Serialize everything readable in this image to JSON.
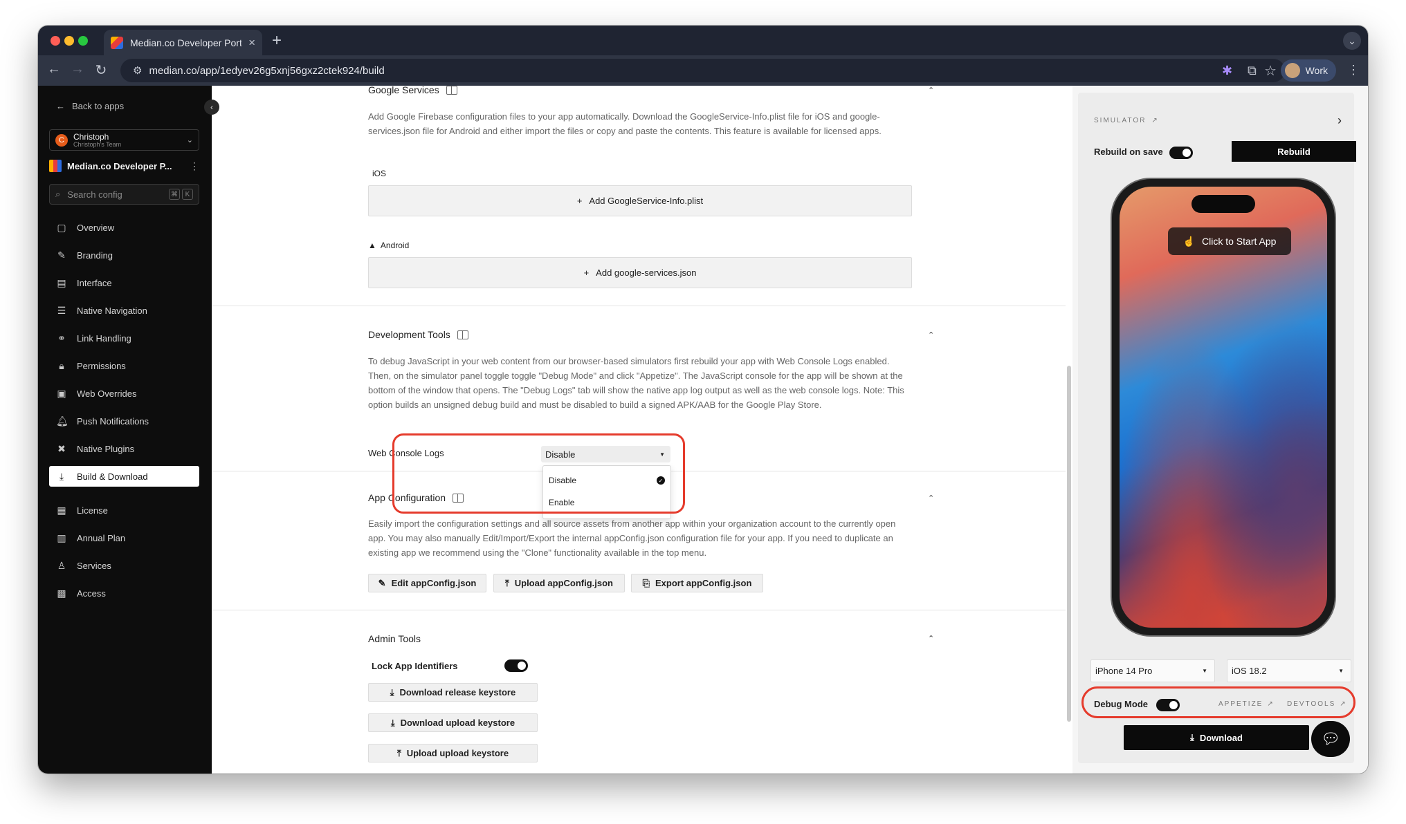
{
  "browser": {
    "tab_title": "Median.co Developer Portal -",
    "tab_close": "×",
    "new_tab": "+",
    "url": "median.co/app/1edyev26g5xnj56gxz2ctek924/build",
    "profile_label": "Work"
  },
  "sidebar": {
    "back_label": "Back to apps",
    "team_name": "Christoph",
    "team_sub": "Christoph's Team",
    "team_initial": "C",
    "app_name": "Median.co Developer P...",
    "search_placeholder": "Search config",
    "search_kbd": [
      "⌘",
      "K"
    ],
    "items": [
      {
        "label": "Overview",
        "icon": "square-icon"
      },
      {
        "label": "Branding",
        "icon": "brush-icon"
      },
      {
        "label": "Interface",
        "icon": "layout-icon"
      },
      {
        "label": "Native Navigation",
        "icon": "navigation-icon"
      },
      {
        "label": "Link Handling",
        "icon": "link-icon"
      },
      {
        "label": "Permissions",
        "icon": "lock-icon"
      },
      {
        "label": "Web Overrides",
        "icon": "code-icon"
      },
      {
        "label": "Push Notifications",
        "icon": "bell-icon"
      },
      {
        "label": "Native Plugins",
        "icon": "plugin-icon"
      },
      {
        "label": "Build & Download",
        "icon": "download-icon",
        "active": true
      }
    ],
    "items2": [
      {
        "label": "License",
        "icon": "license-icon"
      },
      {
        "label": "Annual Plan",
        "icon": "calendar-icon"
      },
      {
        "label": "Services",
        "icon": "person-icon"
      },
      {
        "label": "Access",
        "icon": "access-icon"
      }
    ]
  },
  "google_services": {
    "title": "Google Services",
    "description": "Add Google Firebase configuration files to your app automatically. Download the GoogleService-Info.plist file for iOS and google-services.json file for Android and either import the files or copy and paste the contents. This feature is available for licensed apps.",
    "ios_label": "iOS",
    "ios_button": "Add GoogleService-Info.plist",
    "android_label": "Android",
    "android_button": "Add google-services.json"
  },
  "dev_tools": {
    "title": "Development Tools",
    "description": "To debug JavaScript in your web content from our browser-based simulators first rebuild your app with Web Console Logs enabled. Then, on the simulator panel toggle toggle \"Debug Mode\" and click \"Appetize\". The JavaScript console for the app will be shown at the bottom of the window that opens. The \"Debug Logs\" tab will show the native app log output as well as the web console logs. Note: This option builds an unsigned debug build and must be disabled to build a signed APK/AAB for the Google Play Store.",
    "web_console_label": "Web Console Logs",
    "web_console_value": "Disable",
    "options": [
      "Disable",
      "Enable"
    ]
  },
  "app_config": {
    "title": "App Configuration",
    "description": "Easily import the configuration settings and all source assets from another app within your organization account to the currently open app. You may also manually Edit/Import/Export the internal appConfig.json configuration file for your app. If you need to duplicate an existing app we recommend using the \"Clone\" functionality available in the top menu.",
    "edit_button": "Edit appConfig.json",
    "upload_button": "Upload appConfig.json",
    "export_button": "Export appConfig.json"
  },
  "admin_tools": {
    "title": "Admin Tools",
    "lock_label": "Lock App Identifiers",
    "lock_on": true,
    "release_button": "Download release keystore",
    "upload_dl_button": "Download upload keystore",
    "upload_up_button": "Upload upload keystore"
  },
  "simulator": {
    "label": "SIMULATOR",
    "rebuild_label": "Rebuild on save",
    "rebuild_on": true,
    "rebuild_button": "Rebuild",
    "start_label": "Click to Start App",
    "device": "iPhone 14 Pro",
    "os": "iOS 18.2",
    "debug_label": "Debug Mode",
    "debug_on": true,
    "appetize_label": "APPETIZE",
    "devtools_label": "DEVTOOLS",
    "download_button": "Download"
  },
  "colors": {
    "highlight": "#e53b2c",
    "sidebar_bg": "#0d0d0d",
    "accent": "#0b0b0b"
  }
}
